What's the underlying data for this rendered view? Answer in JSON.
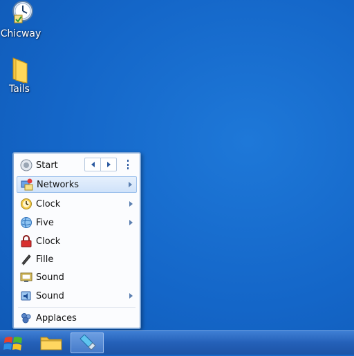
{
  "desktop": {
    "icons": [
      {
        "label": "Chicway",
        "icon": "clock-icon"
      },
      {
        "label": "Tails",
        "icon": "folder-icon"
      }
    ]
  },
  "start_menu": {
    "header": {
      "label": "Start",
      "icon": "start-orb-icon"
    },
    "items": [
      {
        "label": "Networks",
        "icon": "network-icon",
        "submenu": true,
        "highlighted": true
      },
      {
        "label": "Clock",
        "icon": "clock-icon",
        "submenu": true
      },
      {
        "label": "Five",
        "icon": "globe-icon",
        "submenu": true
      },
      {
        "label": "Clock",
        "icon": "lock-icon",
        "submenu": false
      },
      {
        "label": "Fille",
        "icon": "pen-icon",
        "submenu": false
      },
      {
        "label": "Sound",
        "icon": "monitor-icon",
        "submenu": false
      },
      {
        "label": "Sound",
        "icon": "sound-icon",
        "submenu": true
      }
    ],
    "footer": {
      "label": "Applaces",
      "icon": "apps-icon"
    }
  },
  "taskbar": {
    "start_button_icon": "windows-logo-icon",
    "pinned": [
      "folder-icon",
      "usb-drive-icon"
    ]
  },
  "colors": {
    "desktop": "#1466c8",
    "taskbar": "#2460b8",
    "menu_highlight": "#cfe2fa"
  }
}
